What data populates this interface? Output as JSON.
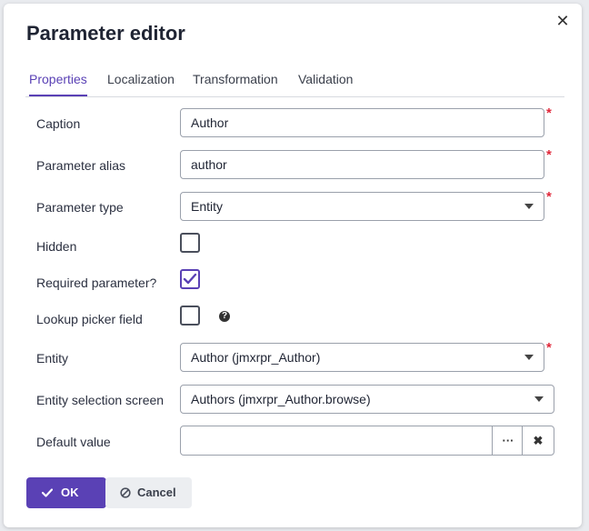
{
  "dialog": {
    "title": "Parameter editor",
    "close_glyph": "✕"
  },
  "tabs": [
    {
      "label": "Properties",
      "active": true
    },
    {
      "label": "Localization",
      "active": false
    },
    {
      "label": "Transformation",
      "active": false
    },
    {
      "label": "Validation",
      "active": false
    }
  ],
  "form": {
    "caption": {
      "label": "Caption",
      "value": "Author",
      "required": true
    },
    "alias": {
      "label": "Parameter alias",
      "value": "author",
      "required": true
    },
    "type": {
      "label": "Parameter type",
      "value": "Entity",
      "required": true
    },
    "hidden": {
      "label": "Hidden",
      "checked": false
    },
    "required_param": {
      "label": "Required parameter?",
      "checked": true
    },
    "lookup": {
      "label": "Lookup picker field",
      "checked": false,
      "help_glyph": "?"
    },
    "entity": {
      "label": "Entity",
      "value": "Author (jmxrpr_Author)",
      "required": true
    },
    "screen": {
      "label": "Entity selection screen",
      "value": "Authors (jmxrpr_Author.browse)"
    },
    "default": {
      "label": "Default value",
      "value": "",
      "lookup_glyph": "···",
      "clear_glyph": "✖"
    }
  },
  "required_marker": "*",
  "buttons": {
    "ok": "OK",
    "cancel": "Cancel"
  },
  "colors": {
    "accent": "#5a41b5",
    "required": "#e0283a"
  }
}
